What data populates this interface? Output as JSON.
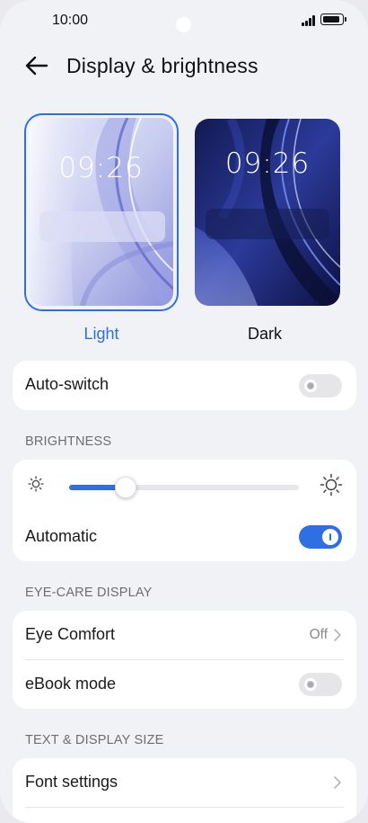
{
  "status_bar": {
    "time": "10:00"
  },
  "header": {
    "title": "Display & brightness"
  },
  "themes": {
    "light": {
      "label": "Light",
      "time": "09:26",
      "selected": true
    },
    "dark": {
      "label": "Dark",
      "time": "09:26",
      "selected": false
    }
  },
  "auto_switch": {
    "label": "Auto-switch",
    "enabled": false
  },
  "brightness": {
    "section_title": "BRIGHTNESS",
    "level_fraction": 0.24,
    "automatic": {
      "label": "Automatic",
      "enabled": true
    }
  },
  "eye_care": {
    "section_title": "EYE-CARE DISPLAY",
    "eye_comfort": {
      "label": "Eye Comfort",
      "value": "Off"
    },
    "ebook_mode": {
      "label": "eBook mode",
      "enabled": false
    }
  },
  "text_display": {
    "section_title": "TEXT & DISPLAY SIZE",
    "font_settings": {
      "label": "Font settings"
    }
  },
  "colors": {
    "accent": "#2f6fe4",
    "background": "#f1f2f6",
    "card": "#ffffff",
    "section_text": "#6e6e72"
  },
  "icons": [
    "back-arrow-icon",
    "sun-small-icon",
    "sun-large-icon",
    "chevron-right-icon",
    "signal-icon",
    "battery-icon"
  ]
}
